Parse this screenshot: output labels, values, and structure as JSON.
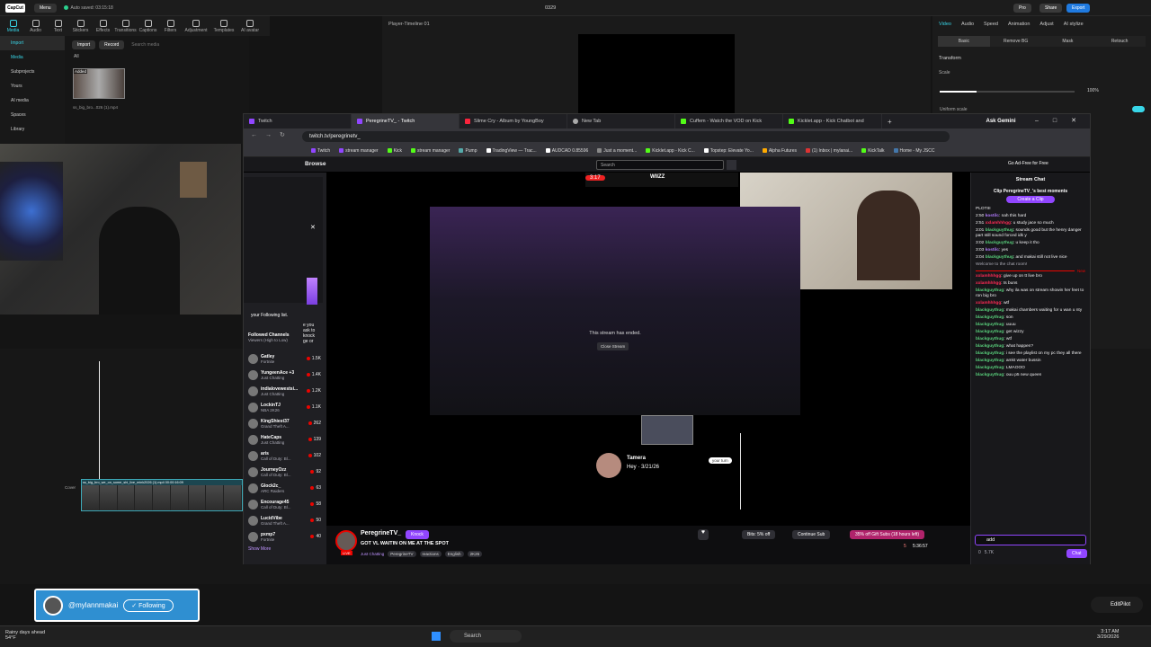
{
  "capcut": {
    "top": {
      "logo": "CapCut",
      "menu": "Menu",
      "autosaved": "Auto saved: 03:15:18",
      "project": "0329",
      "pro": "Pro",
      "share": "Share",
      "export": "Export"
    },
    "tools": [
      "Media",
      "Audio",
      "Text",
      "Stickers",
      "Effects",
      "Transitions",
      "Captions",
      "Filters",
      "Adjustment",
      "Templates",
      "AI avatar"
    ],
    "left_nav": [
      "Import",
      "Media",
      "Subprojects",
      "Yours",
      "AI media",
      "Spaces",
      "Library"
    ],
    "media": {
      "import": "Import",
      "record": "Record",
      "search_placeholder": "Search media",
      "all": "All",
      "added": "Added",
      "clip_name": "ss_big_bro...026 (1).mp4"
    },
    "player_title": "Player-Timeline 01",
    "right_tabs": [
      "Video",
      "Audio",
      "Speed",
      "Animation",
      "Adjust",
      "AI stylize"
    ],
    "right_sub": [
      "Basic",
      "Remove BG",
      "Mask",
      "Retouch"
    ],
    "transform": "Transform",
    "scale": "Scale",
    "scale_value": "100%",
    "uniform_scale": "Uniform scale",
    "clip_label": "ss_big_bro_we_on_some_shi_live_mink2026 (1).mp4  00:00:16:09",
    "cover": "Cover"
  },
  "browser": {
    "tabs": [
      "Twitch",
      "PeregrineTV_ - Twitch",
      "Slime Cry - Album by YoungBoy",
      "New Tab",
      "Cuffem - Watch the VOD on Kick",
      "Kicklet.app - Kick Chatbot and"
    ],
    "gemini": "Ask Gemini",
    "url": "twitch.tv/peregrinetv_",
    "bookmarks": [
      "Twitch",
      "stream manager",
      "Kick",
      "stream manager",
      "Pump",
      "TradingView — Trac...",
      "AUDCAD 0.85596",
      "Just a moment...",
      "Kicklet.app - Kick C...",
      "Topstep: Elevate Yo...",
      "Alpha Futures",
      "(1) Inbox | mylanai...",
      "KickTalk",
      "Home - My JSCC"
    ]
  },
  "twitch": {
    "browse": "Browse",
    "search_placeholder": "Search",
    "ad_free": "Go Ad-Free for Free",
    "followed_title": "Followed Channels",
    "followed_sort": "Viewers (High to Low)",
    "channels": [
      {
        "name": "Gatley",
        "game": "Fortnite",
        "viewers": "1.5K"
      },
      {
        "name": "YungeenAce +3",
        "game": "Just Chatting",
        "viewers": "1.4K"
      },
      {
        "name": "indialovewestsi...",
        "game": "Just Chatting",
        "viewers": "1.2K"
      },
      {
        "name": "LockinTJ",
        "game": "NBA 2K26",
        "viewers": "1.1K"
      },
      {
        "name": "KingShiest37",
        "game": "Grand Theft A...",
        "viewers": "262"
      },
      {
        "name": "HateCaps",
        "game": "Just Chatting",
        "viewers": "139"
      },
      {
        "name": "aris",
        "game": "Call of Duty: Bl...",
        "viewers": "102"
      },
      {
        "name": "JourneyOzz",
        "game": "Call of Duty: Bl...",
        "viewers": "92"
      },
      {
        "name": "Glock2c_",
        "game": "ARC Raiders",
        "viewers": "63"
      },
      {
        "name": "Encourage45",
        "game": "Call of Duty: Bl...",
        "viewers": "58"
      },
      {
        "name": "LucidVibe",
        "game": "Grand Theft A...",
        "viewers": "50"
      },
      {
        "name": "pxmp7",
        "game": "Fortnite",
        "viewers": "40"
      }
    ],
    "show_more": "Show More",
    "popup_text": [
      "e you",
      "ask to",
      "knock",
      "ge or",
      "your Following list."
    ],
    "stream_ended": "This stream has ended.",
    "close_stream": "Close Stream",
    "phone_time": "3:17",
    "phone_brand": "WIIZZ",
    "tamera_name": "Tamera",
    "tamera_date": "Hey · 3/21/26",
    "your_turn": "your turn",
    "streamer": "PeregrineTV_",
    "knock": "Knock",
    "stream_title": "GOT VL WAITIN ON ME AT THE SPOT",
    "category": "Just Chatting",
    "tags": [
      "PeregrineTV",
      "reactions",
      "English",
      "2K26"
    ],
    "live": "LIVE",
    "bits": "Bits: 5% off",
    "continue_sub": "Continue Sub",
    "gift": "35% off Gift Subs (18 hours left)",
    "viewers": "5",
    "uptime": "5:36:57",
    "stream_chat": "Stream Chat",
    "clip_banner": "Clip PeregrineTV_'s best moments",
    "create_clip": "Create a Clip",
    "messages": [
      {
        "t": "",
        "u": "",
        "m": "PLOTIII"
      },
      {
        "t": "2:50",
        "u": "kostilc",
        "m": "nah this hard"
      },
      {
        "t": "2:51",
        "u": "xxlamhhhgg",
        "m": "u study jace so much"
      },
      {
        "t": "3:01",
        "u": "blackguythug",
        "m": "sounds good but the henry danger part still sound forced idk y"
      },
      {
        "t": "3:02",
        "u": "blackguythug",
        "m": "u keep it tho"
      },
      {
        "t": "3:03",
        "u": "kostilc",
        "m": "yes"
      },
      {
        "t": "3:04",
        "u": "blackguythug",
        "m": "and makai still not live nice"
      },
      {
        "t": "",
        "u": "",
        "m": "Welcome to the chat room!"
      },
      {
        "t": "",
        "u": "xxlamhhhgg",
        "m": "give up on tt live bro"
      },
      {
        "t": "",
        "u": "xxlamhhhgg",
        "m": "ts buns"
      },
      {
        "t": "",
        "u": "blackguythug",
        "m": "why ila was on stream showin her feet to ron big bro"
      },
      {
        "t": "",
        "u": "xxlamhhhgg",
        "m": "wtf"
      },
      {
        "t": "",
        "u": "blackguythug",
        "m": "makai chambers waiting for u wan u nty"
      },
      {
        "t": "",
        "u": "blackguythug",
        "m": "son"
      },
      {
        "t": "",
        "u": "blackguythug",
        "m": "uuuu"
      },
      {
        "t": "",
        "u": "blackguythug",
        "m": "get wizzy"
      },
      {
        "t": "",
        "u": "blackguythug",
        "m": "wtf"
      },
      {
        "t": "",
        "u": "blackguythug",
        "m": "what happen?"
      },
      {
        "t": "",
        "u": "blackguythug",
        "m": "i see the playlist on my pc they all there"
      },
      {
        "t": "",
        "u": "blackguythug",
        "m": "amkt water bussin"
      },
      {
        "t": "",
        "u": "blackguythug",
        "m": "LMAOOO"
      },
      {
        "t": "",
        "u": "blackguythug",
        "m": "ouu p5 new queen"
      }
    ],
    "new_label": "New",
    "chat_input": "add",
    "points": "0",
    "points2": "5.7K",
    "chat_button": "Chat"
  },
  "follow": {
    "handle": "@mylannmakai",
    "button": "Following"
  },
  "taskbar": {
    "weather": "Rainy days ahead",
    "temp": "54°F",
    "search": "Search",
    "time": "3:17 AM",
    "date": "3/29/2026",
    "editpilot": "EditPilot"
  }
}
